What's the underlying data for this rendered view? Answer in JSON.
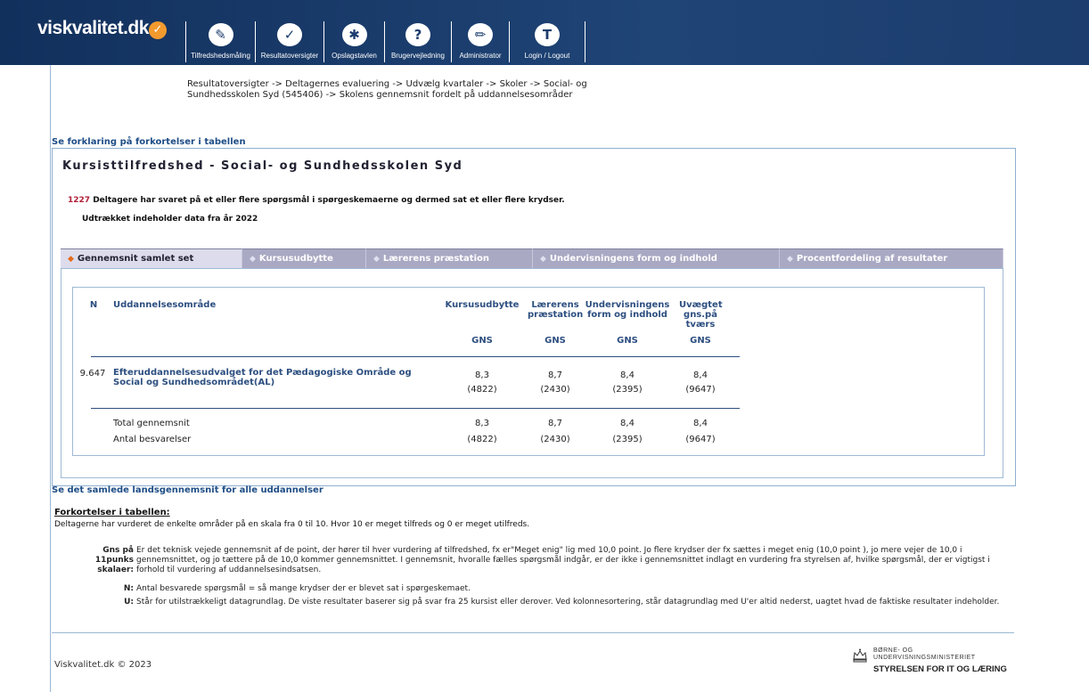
{
  "header": {
    "logo": "viskvalitet.dk",
    "nav": [
      {
        "label": "Tilfredshedsmåling",
        "icon": "pencil-stripes-icon"
      },
      {
        "label": "Resultatoversigter",
        "icon": "checkmark-icon"
      },
      {
        "label": "Opslagstavlen",
        "icon": "pin-icon"
      },
      {
        "label": "Brugervejledning",
        "icon": "question-icon"
      },
      {
        "label": "Administrator",
        "icon": "pencil-icon"
      },
      {
        "label": "Login / Logout",
        "icon": "user-t-icon"
      }
    ]
  },
  "breadcrumb": "Resultatoversigter -> Deltagernes evaluering -> Udvælg kvartaler -> Skoler -> Social- og Sundhedsskolen Syd (545406) -> Skolens gennemsnit fordelt på uddannelsesområder",
  "links": {
    "explain": "Se forklaring på forkortelser i tabellen",
    "national": "Se det samlede landsgennemsnit for alle uddannelser"
  },
  "box": {
    "title": "Kursisttilfredshed - Social- og Sundhedsskolen Syd",
    "respondents_count": "1227",
    "respondents_text": "Deltagere har svaret på et eller flere spørgsmål i spørgeskemaerne og dermed sat et eller flere krydser.",
    "data_year": "Udtrækket indeholder data fra år 2022"
  },
  "tabs": [
    {
      "label": "Gennemsnit samlet set",
      "active": true
    },
    {
      "label": "Kursusudbytte"
    },
    {
      "label": "Lærerens præstation"
    },
    {
      "label": "Undervisningens form og indhold"
    },
    {
      "label": "Procentfordeling af resultater"
    }
  ],
  "table": {
    "headers": {
      "n": "N",
      "area": "Uddannelsesområde",
      "c1": "Kursusudbytte",
      "c2": "Lærerens præstation",
      "c3": "Undervisningens form og indhold",
      "c4": "Uvægtet gns.på tværs",
      "gns": "GNS"
    },
    "row": {
      "n": "9.647",
      "area": "Efteruddannelsesudvalget for det Pædagogiske Område og Social og Sundhedsområdet(AL)",
      "values": [
        "8,3",
        "8,7",
        "8,4",
        "8,4"
      ],
      "counts": [
        "(4822)",
        "(2430)",
        "(2395)",
        "(9647)"
      ]
    },
    "total": {
      "label": "Total gennemsnit",
      "count_label": "Antal besvarelser",
      "values": [
        "8,3",
        "8,7",
        "8,4",
        "8,4"
      ],
      "counts": [
        "(4822)",
        "(2430)",
        "(2395)",
        "(9647)"
      ]
    }
  },
  "abbreviations": {
    "title": "Forkortelser i tabellen:",
    "intro": "Deltagerne har vurderet de enkelte områder på en skala fra 0 til 10. Hvor 10 er meget tilfreds og 0 er meget utilfreds.",
    "gns_term": "Gns på 11punks skalaer:",
    "gns_text": "Er det teknisk vejede gennemsnit af de point, der hører til hver vurdering af tilfredshed, fx er\"Meget enig\" lig med 10,0 point. Jo flere krydser der fx sættes i meget enig (10,0 point ), jo mere vejer de 10,0 i gennemsnittet, og jo tættere på de 10,0 kommer gennemsnittet. I gennemsnit, hvoralle fælles spørgsmål indgår, er der ikke i gennemsnittet indlagt en vurdering fra styrelsen af, hvilke spørgsmål, der er vigtigst i forhold til vurdering af uddannelsesindsatsen.",
    "n_term": "N:",
    "n_text": "Antal besvarede spørgsmål = så mange krydser der er blevet sat i spørgeskemaet.",
    "u_term": "U:",
    "u_text": "Står for utilstrækkeligt datagrundlag. De viste resultater baserer sig på svar fra 25 kursist eller derover. Ved kolonnesortering, står datagrundlag med U'er altid nederst, uagtet hvad de faktiske resultater indeholder."
  },
  "footer": {
    "copyright": "Viskvalitet.dk © 2023",
    "ministry_line1": "BØRNE- OG",
    "ministry_line2": "UNDERVISNINGSMINISTERIET",
    "ministry_line3": "STYRELSEN FOR IT OG LÆRING"
  }
}
